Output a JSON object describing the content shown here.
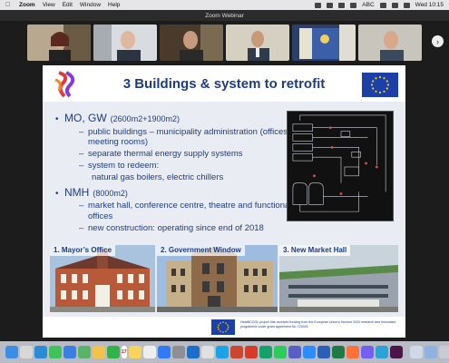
{
  "menubar": {
    "items": [
      "Zoom",
      "View",
      "Edit",
      "Window",
      "Help"
    ],
    "status": {
      "keyboard": "ABC",
      "time": "Wed 10:15"
    }
  },
  "window": {
    "title": "Zoom Webinar"
  },
  "gallery": {
    "participants": [
      {
        "tile_color": "#8a7a6a"
      },
      {
        "tile_color": "#9aa0a8"
      },
      {
        "tile_color": "#6b5a4a"
      },
      {
        "tile_color": "#c9c2b3"
      },
      {
        "tile_color": "#9ab0d2"
      },
      {
        "tile_color": "#c8c8c0"
      },
      {
        "tile_color": "#d8dde0"
      }
    ],
    "next_label": "›"
  },
  "slide": {
    "title": "3 Buildings & system to retrofit",
    "sections": [
      {
        "heading": "MO, GW",
        "area": "(2600m2+1900m2)",
        "points": [
          {
            "text": "public buildings – municipality administration (offices, meeting rooms)"
          },
          {
            "text": "separate thermal energy supply systems"
          },
          {
            "text": "system to redeem:",
            "detail": "natural gas boilers, electric chillers"
          }
        ]
      },
      {
        "heading": "NMH",
        "area": "(8000m2)",
        "points": [
          {
            "text": "market hall, conference centre, theatre and functional offices"
          },
          {
            "text": "new construction: operating since end of 2018"
          }
        ]
      }
    ],
    "photos": [
      {
        "caption": "1. Mayor’s Office",
        "sky": "#a9c3de",
        "building": "#b85a3a"
      },
      {
        "caption": "2. Government Window",
        "sky": "#9ebbe0",
        "building": "#8c6a4a"
      },
      {
        "caption": "3. New Market Hall",
        "sky": "#c9d3dc",
        "building": "#9aa3ad"
      }
    ],
    "footer": "HeatNCOOL project has received funding from the European Union's Horizon 2020 research and innovation programme under grant agreement No 723925"
  },
  "dock": {
    "calendar_day": "17",
    "apps": [
      {
        "name": "finder",
        "color": "#3a8ee6"
      },
      {
        "name": "launchpad",
        "color": "#d8d8d8"
      },
      {
        "name": "safari",
        "color": "#2a8bd6"
      },
      {
        "name": "messages",
        "color": "#3dc35a"
      },
      {
        "name": "mail",
        "color": "#3b7fe0"
      },
      {
        "name": "maps",
        "color": "#59b36b"
      },
      {
        "name": "photos",
        "color": "#f2c24a"
      },
      {
        "name": "facetime",
        "color": "#33b24a"
      },
      {
        "name": "calendar",
        "color": "#ffffff"
      },
      {
        "name": "notes",
        "color": "#f6d55c"
      },
      {
        "name": "reminders",
        "color": "#eeeeee"
      },
      {
        "name": "app-store",
        "color": "#2f7cf6"
      },
      {
        "name": "settings",
        "color": "#8e8e93"
      },
      {
        "name": "outlook",
        "color": "#1b6fc9"
      },
      {
        "name": "chrome",
        "color": "#e0e0e0"
      },
      {
        "name": "skype",
        "color": "#1aa3e8"
      },
      {
        "name": "powerpoint",
        "color": "#c9462f"
      },
      {
        "name": "acrobat",
        "color": "#d83a2a"
      },
      {
        "name": "grammarly",
        "color": "#16a06a"
      },
      {
        "name": "whatsapp",
        "color": "#2dcb5a"
      },
      {
        "name": "teams",
        "color": "#5a5fc7"
      },
      {
        "name": "zoom",
        "color": "#2d8cff"
      },
      {
        "name": "word",
        "color": "#2b5fb8"
      },
      {
        "name": "excel",
        "color": "#1f7a45"
      },
      {
        "name": "firefox",
        "color": "#ff7139"
      },
      {
        "name": "viber",
        "color": "#7360f2"
      },
      {
        "name": "webex",
        "color": "#2aa3d6"
      },
      {
        "name": "slack",
        "color": "#4a154b"
      },
      {
        "name": "preview",
        "color": "#cfd8e6"
      },
      {
        "name": "downloads",
        "color": "#8fb3e0"
      },
      {
        "name": "trash",
        "color": "#c9ccd2"
      }
    ]
  }
}
